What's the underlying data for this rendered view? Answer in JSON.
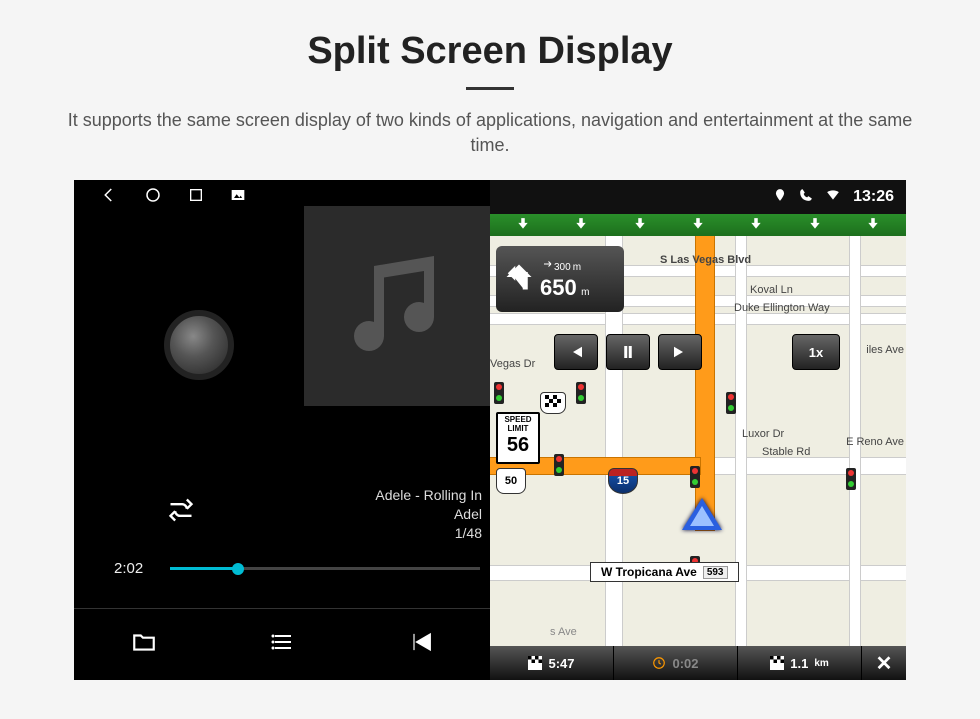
{
  "page": {
    "title": "Split Screen Display",
    "subtitle": "It supports the same screen display of two kinds of applications, navigation and entertainment at the same time."
  },
  "statusbar": {
    "clock": "13:26"
  },
  "music": {
    "track_line1": "Adele - Rolling In",
    "track_line2": "Adel",
    "track_counter": "1/48",
    "elapsed": "2:02"
  },
  "nav_turn": {
    "dist_now": "650",
    "unit_now": "m",
    "dist_next": "300",
    "unit_next": "m"
  },
  "nav_speedlimit": {
    "label1": "SPEED",
    "label2": "LIMIT",
    "value": "56"
  },
  "nav_playback_speed": "1x",
  "shields": {
    "sr593": "593",
    "us50": "50",
    "i15": "15"
  },
  "streets": {
    "s_las_vegas": "S Las Vegas Blvd",
    "koval": "Koval Ln",
    "duke": "Duke Ellington Way",
    "vegas_dr": "Vegas Dr",
    "luxor": "Luxor Dr",
    "stable": "Stable Rd",
    "reno": "E Reno Ave",
    "sas": "s Ave",
    "iles": "iles Ave",
    "tropicana": "W Tropicana Ave"
  },
  "street_sign_num": "593",
  "nav_bottom": {
    "eta": "5:47",
    "drive_time": "0:02",
    "dist": "1.1",
    "dist_unit": "km"
  }
}
